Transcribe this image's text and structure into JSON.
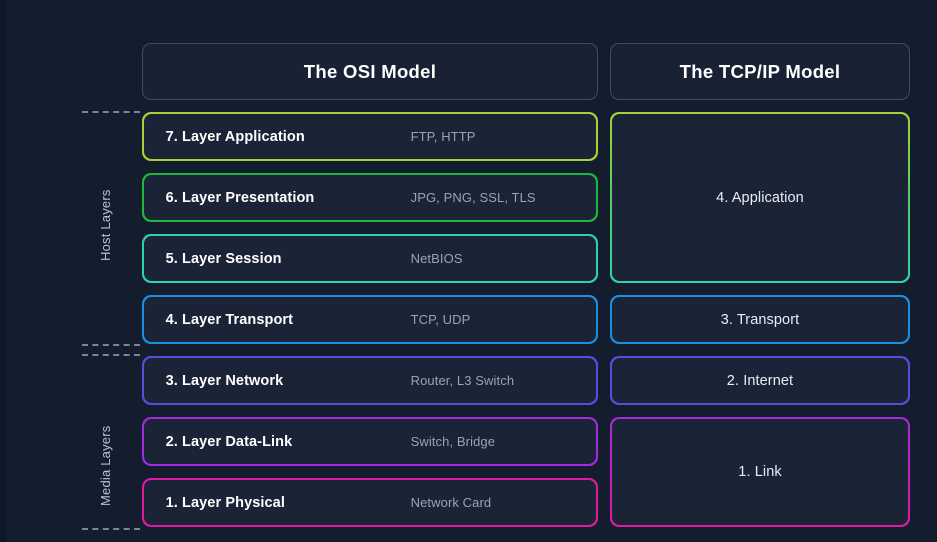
{
  "theme": {
    "page_background": "#141d2e",
    "card_background": "#1b2436",
    "header_border": "#3c4c66",
    "primary_text": "#ffffff",
    "secondary_text": "#97a3b6",
    "group_label_text": "#b8c2d0",
    "dashed_rule": "#7b8798"
  },
  "groups": [
    {
      "id": "host",
      "label": "Host Layers"
    },
    {
      "id": "media",
      "label": "Media Layers"
    }
  ],
  "columns": {
    "osi": {
      "header": "The OSI Model"
    },
    "tcpip": {
      "header": "The TCP/IP Model"
    }
  },
  "osi_layers": [
    {
      "number": "7",
      "name": "7. Layer Application",
      "protocols": "FTP, HTTP",
      "color": "#a3d435",
      "group": "host"
    },
    {
      "number": "6",
      "name": "6. Layer Presentation",
      "protocols": "JPG, PNG, SSL, TLS",
      "color": "#1fb83c",
      "group": "host"
    },
    {
      "number": "5",
      "name": "5. Layer Session",
      "protocols": "NetBIOS",
      "color": "#2dd4a8",
      "group": "host"
    },
    {
      "number": "4",
      "name": "4. Layer Transport",
      "protocols": "TCP, UDP",
      "color": "#1a8fe0",
      "group": "host"
    },
    {
      "number": "3",
      "name": "3. Layer Network",
      "protocols": "Router, L3 Switch",
      "color": "#5b4ce0",
      "group": "media"
    },
    {
      "number": "2",
      "name": "2. Layer Data-Link",
      "protocols": "Switch, Bridge",
      "color": "#a32ae0",
      "group": "media"
    },
    {
      "number": "1",
      "name": "1. Layer Physical",
      "protocols": "Network Card",
      "color": "#e01a9e",
      "group": "media"
    }
  ],
  "tcpip_layers": [
    {
      "number": "4",
      "name": "4. Application",
      "color_start": "#a3d435",
      "color_end": "#2dd4a8",
      "spans": [
        "7",
        "6",
        "5"
      ]
    },
    {
      "number": "3",
      "name": "3. Transport",
      "color_start": "#1a8fe0",
      "color_end": "#1a8fe0",
      "spans": [
        "4"
      ]
    },
    {
      "number": "2",
      "name": "2. Internet",
      "color_start": "#5b4ce0",
      "color_end": "#5b4ce0",
      "spans": [
        "3"
      ]
    },
    {
      "number": "1",
      "name": "1. Link",
      "color_start": "#a32ae0",
      "color_end": "#e01a9e",
      "spans": [
        "2",
        "1"
      ]
    }
  ]
}
